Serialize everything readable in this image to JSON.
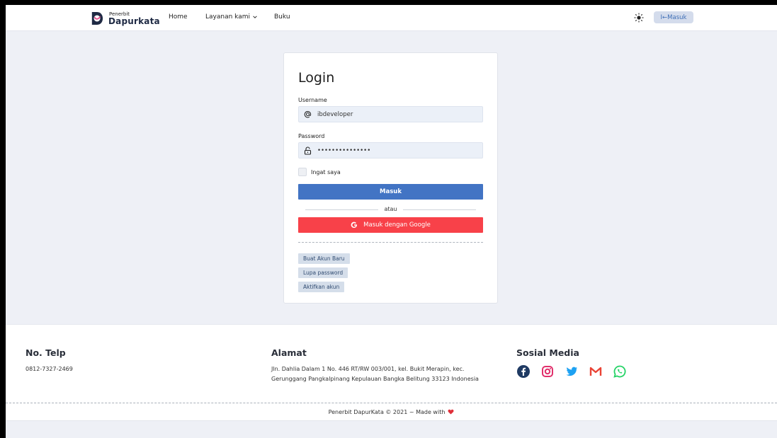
{
  "navbar": {
    "brand_small": "Penerbit",
    "brand_big": "Dapurkata",
    "items": [
      {
        "label": "Home"
      },
      {
        "label": "Layanan kami"
      },
      {
        "label": "Buku"
      }
    ],
    "login_label": "I←Masuk"
  },
  "login": {
    "title": "Login",
    "username_label": "Username",
    "username_value": "ibdeveloper",
    "password_label": "Password",
    "password_value": "ibdeveloper1234",
    "remember_label": "Ingat saya",
    "submit_label": "Masuk",
    "divider_text": "atau",
    "google_label": "Masuk dengan Google",
    "links": [
      {
        "label": "Buat Akun Baru"
      },
      {
        "label": "Lupa password"
      },
      {
        "label": "Aktifkan akun"
      }
    ]
  },
  "footer": {
    "phone_title": "No. Telp",
    "phone_value": "0812-7327-2469",
    "address_title": "Alamat",
    "address_line1": "Jln. Dahlia Dalam 1 No. 446 RT/RW 003/001, kel. Bukit Merapin, kec.",
    "address_line2": "Gerunggang Pangkalpinang Kepulauan Bangka Belitung 33123 Indonesia",
    "social_title": "Sosial Media",
    "social_icons": [
      "facebook-icon",
      "instagram-icon",
      "twitter-icon",
      "gmail-icon",
      "whatsapp-icon"
    ],
    "copyright": "Penerbit DapurKata © 2021 ~ Made with"
  },
  "colors": {
    "primary": "#4274c4",
    "google": "#f84149",
    "background": "#eef0f6"
  }
}
